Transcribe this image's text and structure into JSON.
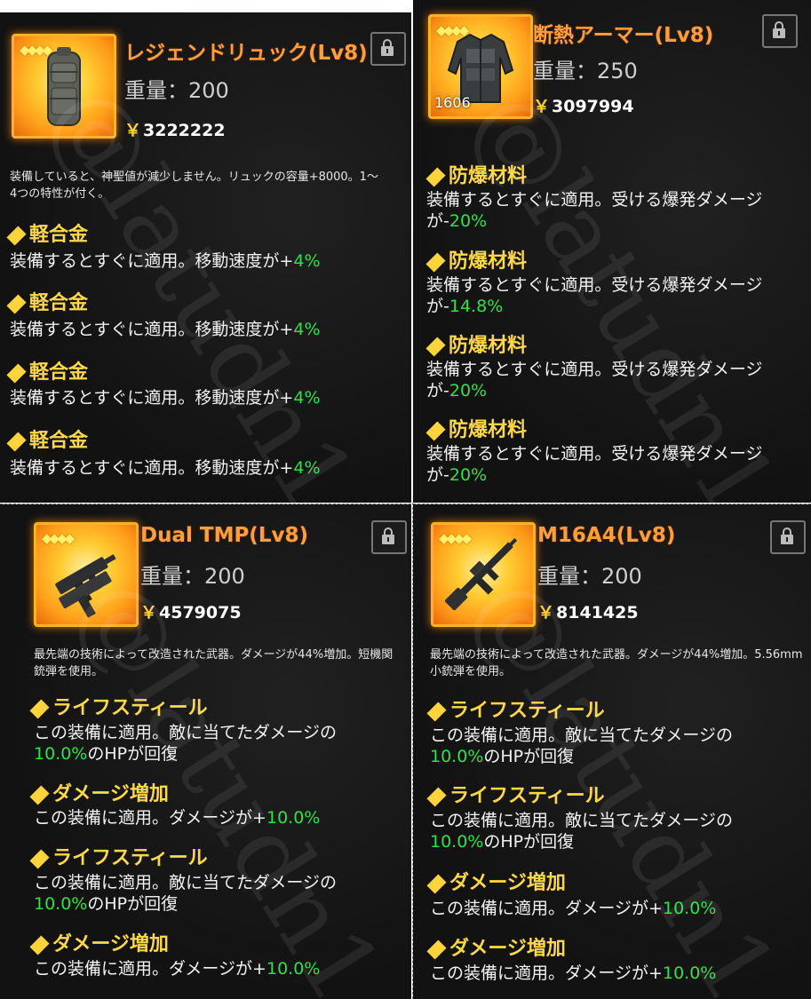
{
  "watermark": "@latudn1",
  "cards": [
    {
      "title": "レジェンドリュック(Lv8)",
      "weight": "重量：200",
      "price": "3222222",
      "currency": "￥",
      "stars": "◆◆◆◆",
      "description": "装備していると、神聖値が減少しません。リュックの容量+8000。1～4つの特性が付く。",
      "traits": [
        {
          "name": "軽合金",
          "text": "装備するとすぐに適用。移動速度が+",
          "value": "4%"
        },
        {
          "name": "軽合金",
          "text": "装備するとすぐに適用。移動速度が+",
          "value": "4%"
        },
        {
          "name": "軽合金",
          "text": "装備するとすぐに適用。移動速度が+",
          "value": "4%"
        },
        {
          "name": "軽合金",
          "text": "装備するとすぐに適用。移動速度が+",
          "value": "4%"
        }
      ]
    },
    {
      "title": "断熱アーマー(Lv8)",
      "weight": "重量：250",
      "price": "3097994",
      "currency": "￥",
      "stars": "◆◆◆◆",
      "item_id": "1606",
      "traits": [
        {
          "name": "防爆材料",
          "text": "装備するとすぐに適用。受ける爆発ダメージが-",
          "value": "20%"
        },
        {
          "name": "防爆材料",
          "text": "装備するとすぐに適用。受ける爆発ダメージが-",
          "value": "14.8%"
        },
        {
          "name": "防爆材料",
          "text": "装備するとすぐに適用。受ける爆発ダメージが-",
          "value": "20%"
        },
        {
          "name": "防爆材料",
          "text": "装備するとすぐに適用。受ける爆発ダメージが-",
          "value": "20%"
        }
      ]
    },
    {
      "title": "Dual TMP(Lv8)",
      "weight": "重量：200",
      "price": "4579075",
      "currency": "￥",
      "stars": "◆◆◆◆",
      "description": "最先端の技術によって改造された武器。ダメージが44%増加。短機関銃弾を使用。",
      "traits": [
        {
          "name": "ライフスティール",
          "text_before": "この装備に適用。敵に当てたダメージの",
          "value": "10.0%",
          "text_after": "のHPが回復"
        },
        {
          "name": "ダメージ増加",
          "text": "この装備に適用。ダメージが+",
          "value": "10.0%"
        },
        {
          "name": "ライフスティール",
          "text_before": "この装備に適用。敵に当てたダメージの",
          "value": "10.0%",
          "text_after": "のHPが回復"
        },
        {
          "name": "ダメージ増加",
          "text": "この装備に適用。ダメージが+",
          "value": "10.0%"
        }
      ]
    },
    {
      "title": "M16A4(Lv8)",
      "weight": "重量：200",
      "price": "8141425",
      "currency": "￥",
      "stars": "◆◆◆◆",
      "description": "最先端の技術によって改造された武器。ダメージが44%増加。5.56mm小銃弾を使用。",
      "traits": [
        {
          "name": "ライフスティール",
          "text_before": "この装備に適用。敵に当てたダメージの",
          "value": "10.0%",
          "text_after": "のHPが回復"
        },
        {
          "name": "ライフスティール",
          "text_before": "この装備に適用。敵に当てたダメージの",
          "value": "10.0%",
          "text_after": "のHPが回復"
        },
        {
          "name": "ダメージ増加",
          "text": "この装備に適用。ダメージが+",
          "value": "10.0%"
        },
        {
          "name": "ダメージ増加",
          "text": "この装備に適用。ダメージが+",
          "value": "10.0%"
        }
      ]
    }
  ],
  "colors": {
    "title": "#ff9e3d",
    "trait": "#ffd84a",
    "positive": "#2fe04a",
    "frame": "#ffb12b"
  }
}
